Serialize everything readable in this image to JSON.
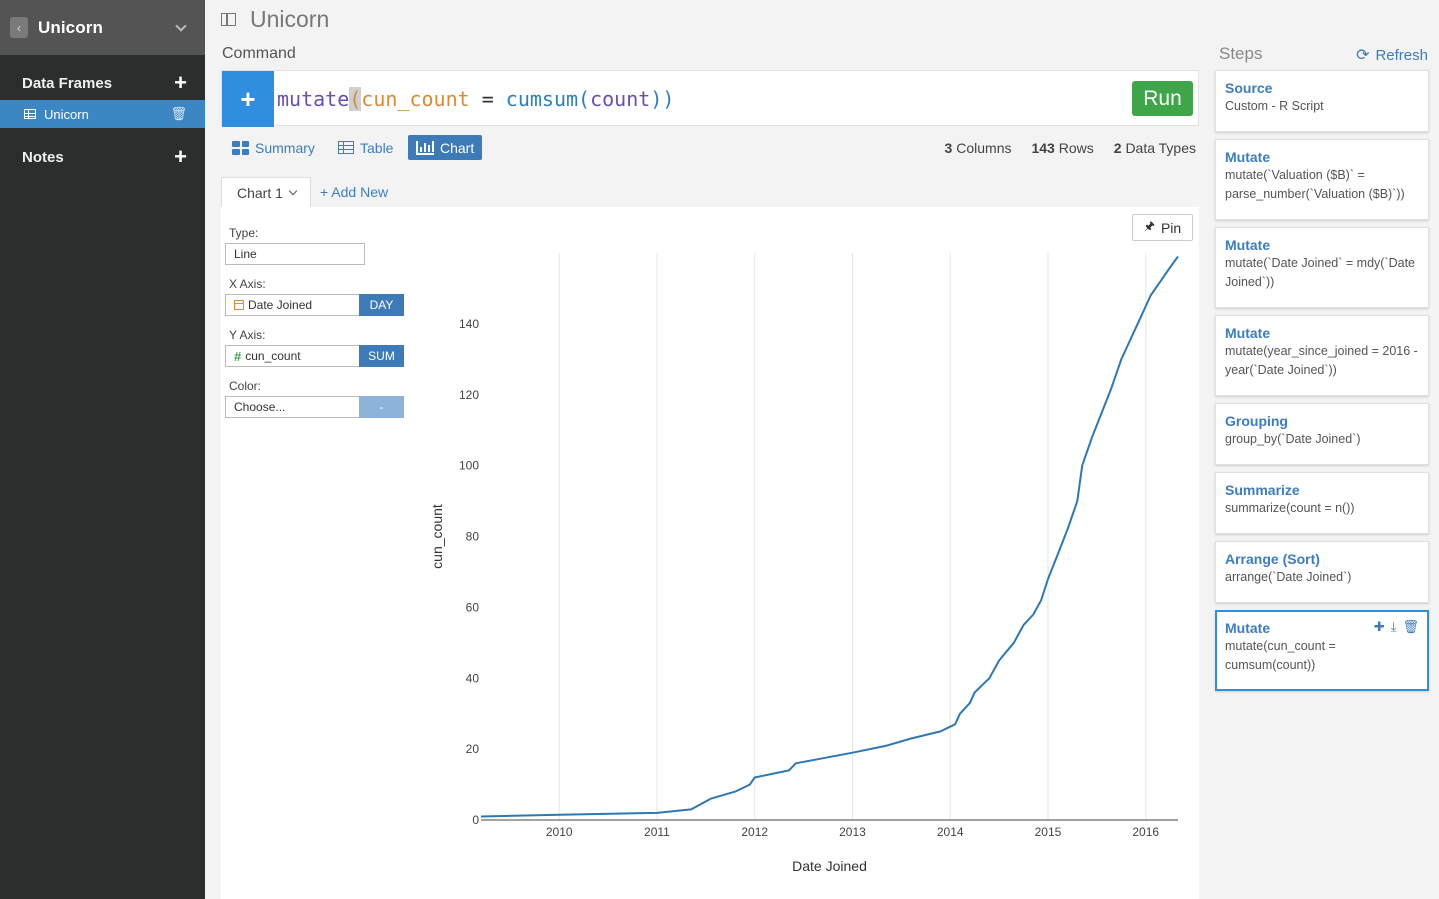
{
  "sidebar": {
    "title": "Unicorn",
    "sections": {
      "data_frames": "Data Frames",
      "notes": "Notes"
    },
    "items": [
      {
        "label": "Unicorn"
      }
    ]
  },
  "header": {
    "title": "Unicorn",
    "command_label": "Command"
  },
  "command": {
    "code_fn": "mutate",
    "code_open": "(",
    "code_var": "cun_count",
    "code_op": " = ",
    "code_fn2": "cumsum",
    "code_open2": "(",
    "code_arg": "count",
    "code_close": "))",
    "run_label": "Run"
  },
  "view_tabs": [
    {
      "label": "Summary"
    },
    {
      "label": "Table"
    },
    {
      "label": "Chart"
    }
  ],
  "stats": {
    "columns_n": "3",
    "columns_label": "Columns",
    "rows_n": "143",
    "rows_label": "Rows",
    "types_n": "2",
    "types_label": "Data Types"
  },
  "chart_tabs": {
    "current": "Chart 1",
    "add_new": "+ Add New"
  },
  "config": {
    "type_label": "Type:",
    "type_value": "Line",
    "x_label": "X Axis:",
    "x_value": "Date Joined",
    "x_agg": "DAY",
    "y_label": "Y Axis:",
    "y_value": "cun_count",
    "y_agg": "SUM",
    "color_label": "Color:",
    "color_value": "Choose...",
    "color_agg": "-"
  },
  "pin_label": "Pin",
  "chart_data": {
    "type": "line",
    "xlabel": "Date Joined",
    "ylabel": "cun_count",
    "xlim": [
      2009.2,
      2016.33
    ],
    "ylim": [
      0,
      160
    ],
    "x_ticks": [
      "2010",
      "2011",
      "2012",
      "2013",
      "2014",
      "2015",
      "2016"
    ],
    "y_ticks": [
      0,
      20,
      40,
      60,
      80,
      100,
      120,
      140
    ],
    "grid": true,
    "line_color": "#2c78b5",
    "series": [
      {
        "x": [
          2009.2,
          2010.0,
          2011.0,
          2011.35,
          2011.55,
          2011.8,
          2011.95,
          2012.0,
          2012.35,
          2012.42,
          2013.0,
          2013.35,
          2013.6,
          2013.9,
          2014.05,
          2014.1,
          2014.2,
          2014.25,
          2014.4,
          2014.5,
          2014.65,
          2014.75,
          2014.85,
          2014.93,
          2015.0,
          2015.1,
          2015.2,
          2015.3,
          2015.35,
          2015.45,
          2015.55,
          2015.65,
          2015.75,
          2015.85,
          2015.95,
          2016.05,
          2016.15,
          2016.25,
          2016.33
        ],
        "y": [
          1,
          1.5,
          2,
          3,
          6,
          8,
          10,
          12,
          14,
          16,
          19,
          21,
          23,
          25,
          27,
          30,
          33,
          36,
          40,
          45,
          50,
          55,
          58,
          62,
          68,
          75,
          82,
          90,
          100,
          108,
          115,
          122,
          130,
          136,
          142,
          148,
          152,
          156,
          159
        ]
      }
    ]
  },
  "steps": {
    "label": "Steps",
    "refresh": "Refresh",
    "items": [
      {
        "title": "Source",
        "desc": "Custom - R Script"
      },
      {
        "title": "Mutate",
        "desc": "mutate(`Valuation ($B)` = parse_number(`Valuation ($B)`))"
      },
      {
        "title": "Mutate",
        "desc": "mutate(`Date Joined` = mdy(`Date Joined`))"
      },
      {
        "title": "Mutate",
        "desc": "mutate(year_since_joined = 2016 - year(`Date Joined`))"
      },
      {
        "title": "Grouping",
        "desc": "group_by(`Date Joined`)"
      },
      {
        "title": "Summarize",
        "desc": "summarize(count = n())"
      },
      {
        "title": "Arrange (Sort)",
        "desc": "arrange(`Date Joined`)"
      },
      {
        "title": "Mutate",
        "desc": "mutate(cun_count = cumsum(count))"
      }
    ]
  }
}
